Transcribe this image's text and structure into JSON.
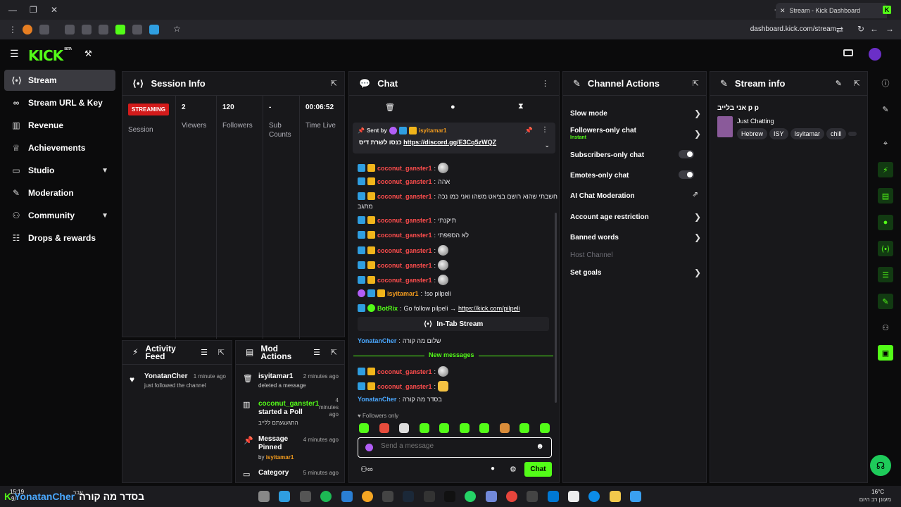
{
  "browser": {
    "tab_title": "Stream - Kick Dashboard",
    "url": "dashboard.kick.com/stream"
  },
  "header": {
    "logo": "KICK",
    "beta": "BETA"
  },
  "sidebar": {
    "items": [
      {
        "label": "Stream",
        "icon": "broadcast-icon"
      },
      {
        "label": "Stream URL & Key",
        "icon": "link-icon"
      },
      {
        "label": "Revenue",
        "icon": "chart-icon"
      },
      {
        "label": "Achievements",
        "icon": "trophy-icon"
      },
      {
        "label": "Studio",
        "icon": "monitor-icon"
      },
      {
        "label": "Moderation",
        "icon": "wrench-icon"
      },
      {
        "label": "Community",
        "icon": "users-icon"
      },
      {
        "label": "Drops & rewards",
        "icon": "gift-icon"
      }
    ]
  },
  "session": {
    "title": "Session Info",
    "status": "STREAMING",
    "status_label": "Session",
    "viewers": "2",
    "viewers_label": "Viewers",
    "followers": "120",
    "followers_label": "Followers",
    "subs": "-",
    "subs_label": "Sub Counts",
    "time": "00:06:52",
    "time_label": "Time Live"
  },
  "activity": {
    "title": "Activity Feed",
    "user": "YonatanCher",
    "time": "1 minute ago",
    "text": "just followed the channel"
  },
  "mod": {
    "title": "Mod Actions",
    "items": [
      {
        "user": "isyitamar1",
        "time": "2 minutes ago",
        "text": "deleted a message"
      },
      {
        "user": "coconut_ganster1",
        "time": "4 minutes ago",
        "text": "started a Poll",
        "sub": "התגעגעתם ללייב"
      },
      {
        "user": "Message Pinned",
        "time": "4 minutes ago",
        "text": "by",
        "by": "isyitamar1"
      },
      {
        "user": "Category",
        "time": "5 minutes ago"
      }
    ]
  },
  "chat": {
    "title": "Chat",
    "pinned_by": "Sent by",
    "pinned_user": "isyitamar1",
    "pinned_text": "כנסו לשרת דיס",
    "pinned_link": "https://discord.gg/E3Cq5zWQZ",
    "messages": [
      {
        "user": "coconut_ganster1",
        "text": ""
      },
      {
        "user": "coconut_ganster1",
        "text": "אהה"
      },
      {
        "user": "coconut_ganster1",
        "text": "חשבתי שהוא רושם בציאט משהו ואני כמו נכה"
      },
      {
        "cont": "מתגב"
      },
      {
        "user": "coconut_ganster1",
        "text": "תיקנתי"
      },
      {
        "user": "coconut_ganster1",
        "text": "לא הספפתי"
      },
      {
        "user": "coconut_ganster1",
        "text": ""
      },
      {
        "user": "coconut_ganster1",
        "text": ""
      },
      {
        "user": "coconut_ganster1",
        "text": ""
      },
      {
        "user": "isyitamar1",
        "text": "!so pilpeli"
      },
      {
        "user": "BotRix",
        "text": "Go follow pilpeli →",
        "link": "https://kick.com/pilpeli"
      }
    ],
    "in_tab": "In-Tab Stream",
    "y_msg_user": "YonatanCher",
    "y_msg_text": "שלום מה קורה",
    "new_messages": "New messages",
    "after": [
      {
        "user": "coconut_ganster1",
        "text": ""
      },
      {
        "user": "coconut_ganster1",
        "text": ""
      },
      {
        "user": "YonatanCher",
        "text": "בסדר מה קורה"
      }
    ],
    "followers_only": "Followers only",
    "placeholder": "Send a message",
    "send": "Chat"
  },
  "channel_actions": {
    "title": "Channel Actions",
    "rows": [
      {
        "label": "Slow mode",
        "ctl": "arrow"
      },
      {
        "label": "Followers-only chat",
        "sub": "Instant",
        "ctl": "arrow"
      },
      {
        "label": "Subscribers-only chat",
        "ctl": "toggle"
      },
      {
        "label": "Emotes-only chat",
        "ctl": "toggle"
      },
      {
        "label": "AI Chat Moderation",
        "ctl": "ext"
      },
      {
        "label": "Account age restriction",
        "ctl": "arrow"
      },
      {
        "label": "Banned words",
        "ctl": "arrow"
      },
      {
        "label": "Host Channel",
        "ctl": "none"
      },
      {
        "label": "Set goals",
        "ctl": "arrow"
      }
    ]
  },
  "stream_info": {
    "title": "Stream info",
    "stream_title": "אני בלייב p p",
    "category": "Just Chatting",
    "tags": [
      "Hebrew",
      "ISY",
      "Isyitamar",
      "chill"
    ]
  },
  "taskbar": {
    "clock": "15:19",
    "date": "9/",
    "overlay_user": "YonatanCher",
    "overlay_text": "בסדר מה קורה",
    "weather_temp": "16°C",
    "weather_text": "מעונן רב היום",
    "lang": "עבר"
  }
}
